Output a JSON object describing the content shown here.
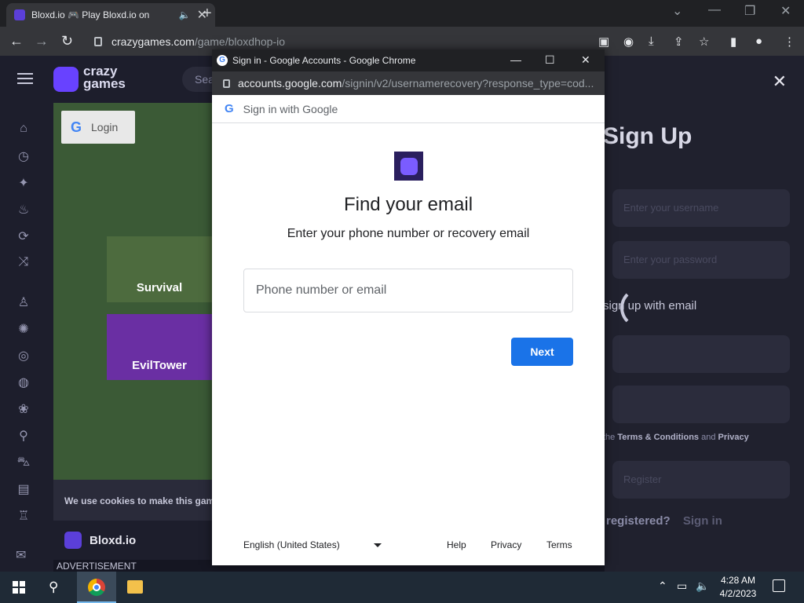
{
  "browser": {
    "tab_title": "Bloxd.io 🎮 Play Bloxd.io on",
    "tab_mute_icon": "speaker-icon",
    "url_domain": "crazygames.com",
    "url_path": "/game/bloxdhop-io"
  },
  "page": {
    "logo_text_line1": "crazy",
    "logo_text_line2": "games",
    "search_placeholder": "Sea",
    "login_label": "Login",
    "cards": [
      "Survival",
      "EvilTower"
    ],
    "cookie_text": "We use cookies to make this game",
    "game_name": "Bloxd.io",
    "advertisement": "ADVERTISEMENT"
  },
  "signup": {
    "title": "Sign Up",
    "field1_placeholder": "Enter your username",
    "field2_placeholder": "Enter your password",
    "email_label": "sign up with email",
    "terms_prefix": "the",
    "terms_link": "Terms & Conditions",
    "terms_and": "and",
    "privacy_link": "Privacy",
    "register_button": "Register",
    "registered_text": "registered?",
    "signin_link": "Sign in"
  },
  "popup": {
    "window_title": "Sign in - Google Accounts - Google Chrome",
    "url_domain": "accounts.google.com",
    "url_path": "/signin/v2/usernamerecovery?response_type=cod...",
    "header_label": "Sign in with Google",
    "heading": "Find your email",
    "subheading": "Enter your phone number or recovery email",
    "input_placeholder": "Phone number or email",
    "next_label": "Next",
    "language": "English (United States)",
    "footer_links": [
      "Help",
      "Privacy",
      "Terms"
    ]
  },
  "taskbar": {
    "time": "4:28 AM",
    "date": "4/2/2023"
  },
  "colors": {
    "google_blue": "#1a73e8",
    "crazygames_purple": "#6842ff"
  }
}
